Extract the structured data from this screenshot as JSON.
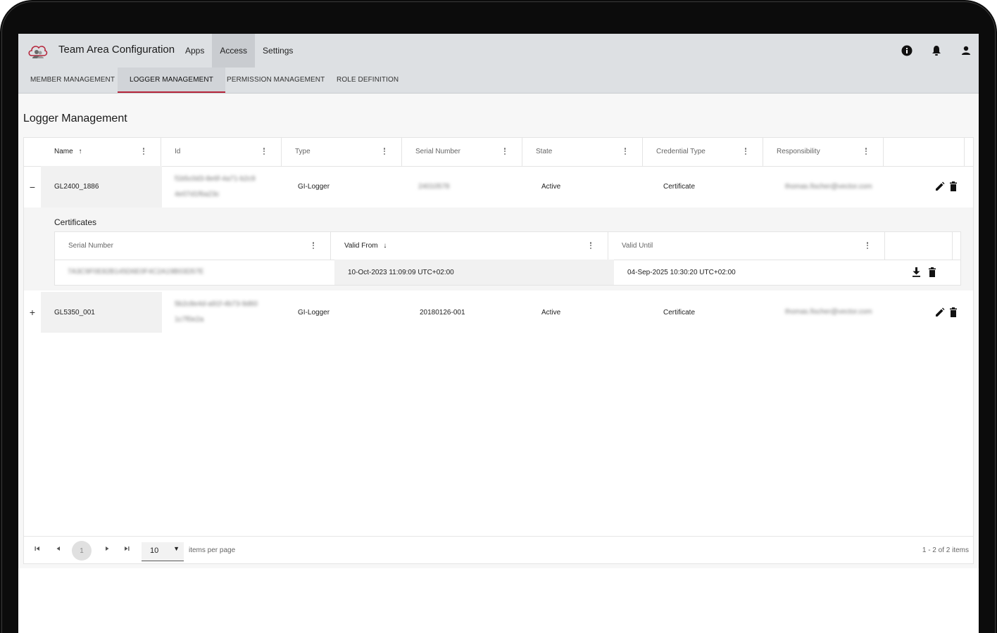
{
  "app": {
    "title": "Team Area Configuration",
    "nav": [
      {
        "label": "Apps",
        "active": false
      },
      {
        "label": "Access",
        "active": true
      },
      {
        "label": "Settings",
        "active": false
      }
    ]
  },
  "subtabs": [
    {
      "label": "MEMBER MANAGEMENT",
      "active": false
    },
    {
      "label": "LOGGER MANAGEMENT",
      "active": true
    },
    {
      "label": "PERMISSION MANAGEMENT",
      "active": false
    },
    {
      "label": "ROLE DEFINITION",
      "active": false
    }
  ],
  "page": {
    "title": "Logger Management"
  },
  "table": {
    "columns": [
      {
        "label": "Name",
        "sort": "↑"
      },
      {
        "label": "Id",
        "sort": ""
      },
      {
        "label": "Type",
        "sort": ""
      },
      {
        "label": "Serial Number",
        "sort": ""
      },
      {
        "label": "State",
        "sort": ""
      },
      {
        "label": "Credential Type",
        "sort": ""
      },
      {
        "label": "Responsibility",
        "sort": ""
      }
    ],
    "rows": [
      {
        "expander": "−",
        "name": "GL2400_1886",
        "id_line1": "f1b5c0d3-8e6f-4a71-b2c9",
        "id_line2": "4e07d1f6a23c",
        "type": "GI-Logger",
        "serial": "24010578",
        "state": "Active",
        "credential_type": "Certificate",
        "responsibility": "thomas.fischer@vector.com"
      },
      {
        "expander": "+",
        "name": "GL5350_001",
        "id_line1": "5b2c8e4d-a91f-4b73-9d60",
        "id_line2": "1c7f0e2a",
        "type": "GI-Logger",
        "serial": "20180126-001",
        "state": "Active",
        "credential_type": "Certificate",
        "responsibility": "thomas.fischer@vector.com"
      }
    ]
  },
  "certificates": {
    "title": "Certificates",
    "columns": [
      {
        "label": "Serial Number",
        "sort": ""
      },
      {
        "label": "Valid From",
        "sort": "↓"
      },
      {
        "label": "Valid Until",
        "sort": ""
      }
    ],
    "rows": [
      {
        "serial": "7A3C9F0E82B145D6E0F4C2A19B03D57E",
        "valid_from": "10-Oct-2023 11:09:09 UTC+02:00",
        "valid_until": "04-Sep-2025 10:30:20 UTC+02:00"
      }
    ]
  },
  "pager": {
    "current_page": "1",
    "page_size": "10",
    "page_size_label": "items per page",
    "info": "1 - 2 of 2 items"
  },
  "colors": {
    "accent": "#b5243a",
    "appbar": "#dde0e3"
  },
  "icons": [
    "cloud-logo-icon",
    "info-icon",
    "bell-icon",
    "user-icon",
    "edit-icon",
    "delete-icon",
    "download-icon",
    "kebab-icon",
    "first-page-icon",
    "prev-page-icon",
    "next-page-icon",
    "last-page-icon",
    "dropdown-arrow-icon"
  ]
}
